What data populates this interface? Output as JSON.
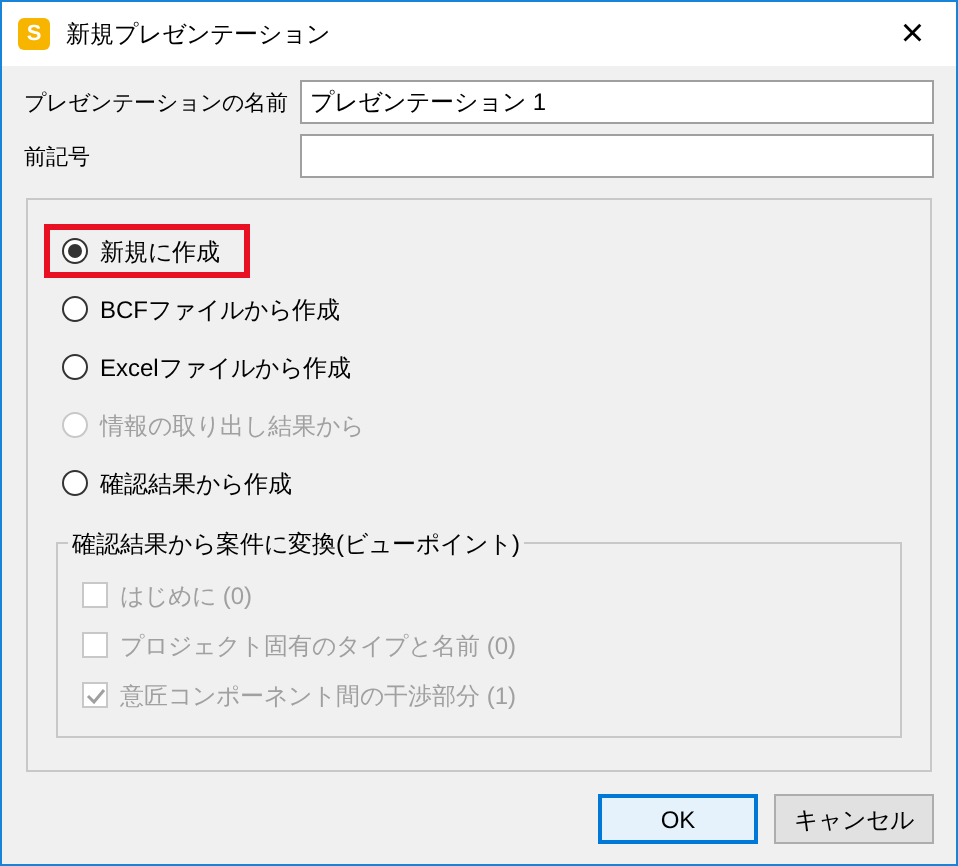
{
  "window": {
    "title": "新規プレゼンテーション",
    "app_icon": "S",
    "close": "×"
  },
  "fields": [
    {
      "label": "プレゼンテーションの名前",
      "value": "プレゼンテーション 1"
    },
    {
      "label": "前記号"
    }
  ],
  "options": [
    {
      "label": "新規に作成",
      "selected": true,
      "disabled": false,
      "highlighted": true
    },
    {
      "label": "BCFファイルから作成",
      "selected": false,
      "disabled": false,
      "highlighted": false
    },
    {
      "label": "Excelファイルから作成",
      "selected": false,
      "disabled": false,
      "highlighted": false
    },
    {
      "label": "情報の取り出し結果から",
      "selected": false,
      "disabled": true,
      "highlighted": false
    },
    {
      "label": "確認結果から作成",
      "selected": false,
      "disabled": false,
      "highlighted": false
    }
  ],
  "viewpoints": {
    "title": "確認結果から案件に変換(ビューポイント)",
    "items": [
      {
        "label": "はじめに (0)",
        "checked": false,
        "disabled": true
      },
      {
        "label": "プロジェクト固有のタイプと名前 (0)",
        "checked": false,
        "disabled": true
      },
      {
        "label": "意匠コンポーネント間の干渉部分 (1)",
        "checked": true,
        "disabled": true
      }
    ]
  },
  "buttons": [
    {
      "label": "OK",
      "default": true
    },
    {
      "label": "キャンセル",
      "default": false
    }
  ]
}
